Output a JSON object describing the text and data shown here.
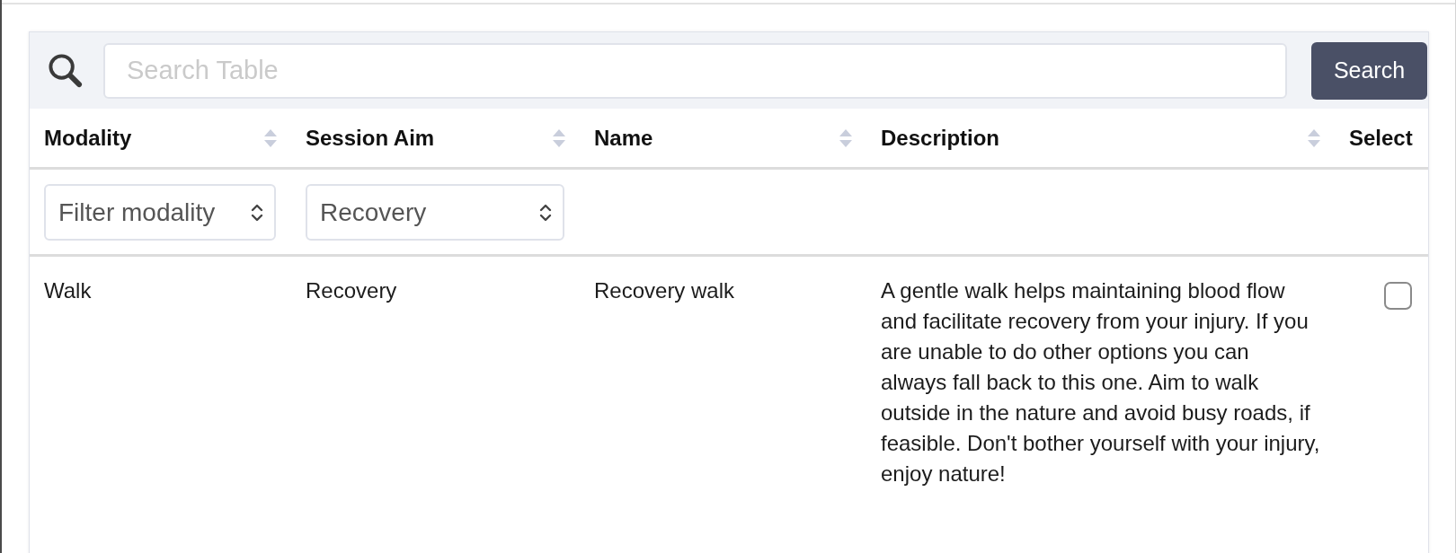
{
  "search": {
    "placeholder": "Search Table",
    "button": "Search"
  },
  "table": {
    "columns": [
      {
        "label": "Modality",
        "sortable": true
      },
      {
        "label": "Session Aim",
        "sortable": true
      },
      {
        "label": "Name",
        "sortable": true
      },
      {
        "label": "Description",
        "sortable": true
      },
      {
        "label": "Select",
        "sortable": false
      }
    ],
    "filters": [
      {
        "kind": "select",
        "placeholder": "Filter modality"
      },
      {
        "kind": "select",
        "value": "Recovery"
      }
    ],
    "rows": [
      {
        "cells": [
          "Walk",
          "Recovery",
          "Recovery walk",
          "A gentle walk helps maintaining blood flow and facilitate recovery from your injury. If you are unable to do other options you can always fall back to this one. Aim to walk outside in the nature and avoid busy roads, if feasible. Don't bother yourself with your injury, enjoy nature!"
        ],
        "checked": false
      }
    ]
  }
}
